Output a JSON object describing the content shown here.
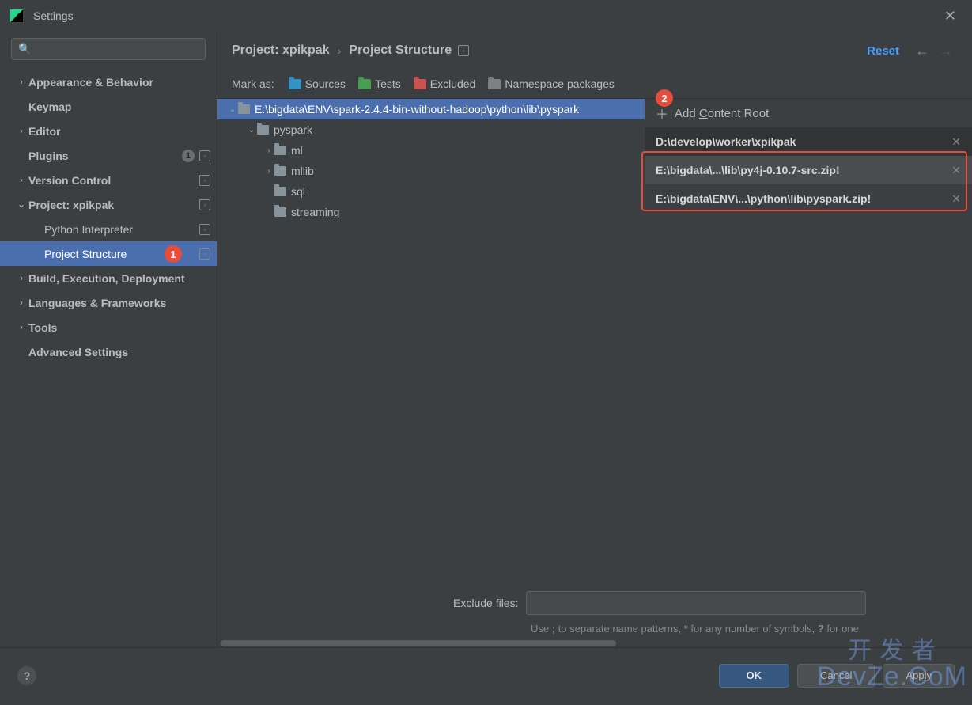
{
  "window": {
    "title": "Settings"
  },
  "sidebar": {
    "items": [
      {
        "label": "Appearance & Behavior",
        "chevron": "›",
        "bold": true
      },
      {
        "label": "Keymap",
        "bold": true
      },
      {
        "label": "Editor",
        "chevron": "›",
        "bold": true
      },
      {
        "label": "Plugins",
        "bold": true,
        "badge": "1",
        "gear": true
      },
      {
        "label": "Version Control",
        "chevron": "›",
        "bold": true,
        "gear": true
      },
      {
        "label": "Project: xpikpak",
        "chevron": "⌄",
        "bold": true,
        "gear": true
      },
      {
        "label": "Python Interpreter",
        "child": true,
        "gear": true
      },
      {
        "label": "Project Structure",
        "child": true,
        "selected": true,
        "gear": true,
        "badge_red": "1"
      },
      {
        "label": "Build, Execution, Deployment",
        "chevron": "›",
        "bold": true
      },
      {
        "label": "Languages & Frameworks",
        "chevron": "›",
        "bold": true
      },
      {
        "label": "Tools",
        "chevron": "›",
        "bold": true
      },
      {
        "label": "Advanced Settings",
        "bold": true
      }
    ]
  },
  "breadcrumb": {
    "segment1": "Project: xpikpak",
    "segment2": "Project Structure",
    "reset": "Reset"
  },
  "mark_as": {
    "label": "Mark as:",
    "sources": "Sources",
    "tests": "Tests",
    "excluded": "Excluded",
    "namespace": "Namespace packages"
  },
  "tree": {
    "root": "E:\\bigdata\\ENV\\spark-2.4.4-bin-without-hadoop\\python\\lib\\pyspark",
    "n1": "pyspark",
    "n2": "ml",
    "n3": "mllib",
    "n4": "sql",
    "n5": "streaming"
  },
  "roots": {
    "add_label": "Add Content Root",
    "items": [
      "D:\\develop\\worker\\xpikpak",
      "E:\\bigdata\\...\\lib\\py4j-0.10.7-src.zip!",
      "E:\\bigdata\\ENV\\...\\python\\lib\\pyspark.zip!"
    ],
    "badge": "2"
  },
  "exclude": {
    "label": "Exclude files:",
    "hint": "Use ; to separate name patterns, * for any number of symbols, ? for one."
  },
  "footer": {
    "ok": "OK",
    "cancel": "Cancel",
    "apply": "Apply"
  },
  "watermark": {
    "cn": "开 发 者",
    "en": "DevZe.CoM"
  }
}
